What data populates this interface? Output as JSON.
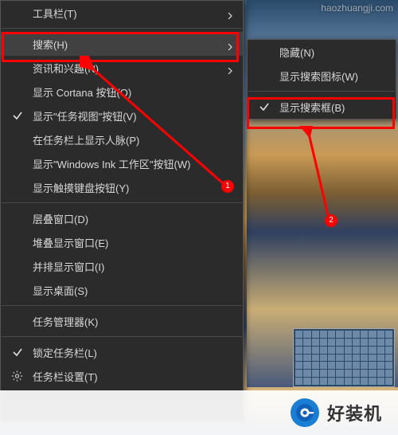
{
  "main_menu": {
    "toolbars": "工具栏(T)",
    "search": "搜索(H)",
    "news": "资讯和兴趣(N)",
    "cortana": "显示 Cortana 按钮(O)",
    "taskview": "显示\"任务视图\"按钮(V)",
    "people": "在任务栏上显示人脉(P)",
    "ink": "显示\"Windows Ink 工作区\"按钮(W)",
    "touchkb": "显示触摸键盘按钮(Y)",
    "cascade": "层叠窗口(D)",
    "stacked": "堆叠显示窗口(E)",
    "sidebyside": "并排显示窗口(I)",
    "showdesktop": "显示桌面(S)",
    "taskmgr": "任务管理器(K)",
    "locktaskbar": "锁定任务栏(L)",
    "settings": "任务栏设置(T)"
  },
  "sub_menu": {
    "hidden": "隐藏(N)",
    "showicon": "显示搜索图标(W)",
    "showbox": "显示搜索框(B)"
  },
  "annotations": {
    "one": "1",
    "two": "2"
  },
  "branding": {
    "text": "好装机",
    "watermark": "haozhuangji.com"
  },
  "colors": {
    "highlight": "#ff0000",
    "menu_bg": "#2b2b2b",
    "hover": "#414141",
    "accent": "#1a7fd4"
  }
}
